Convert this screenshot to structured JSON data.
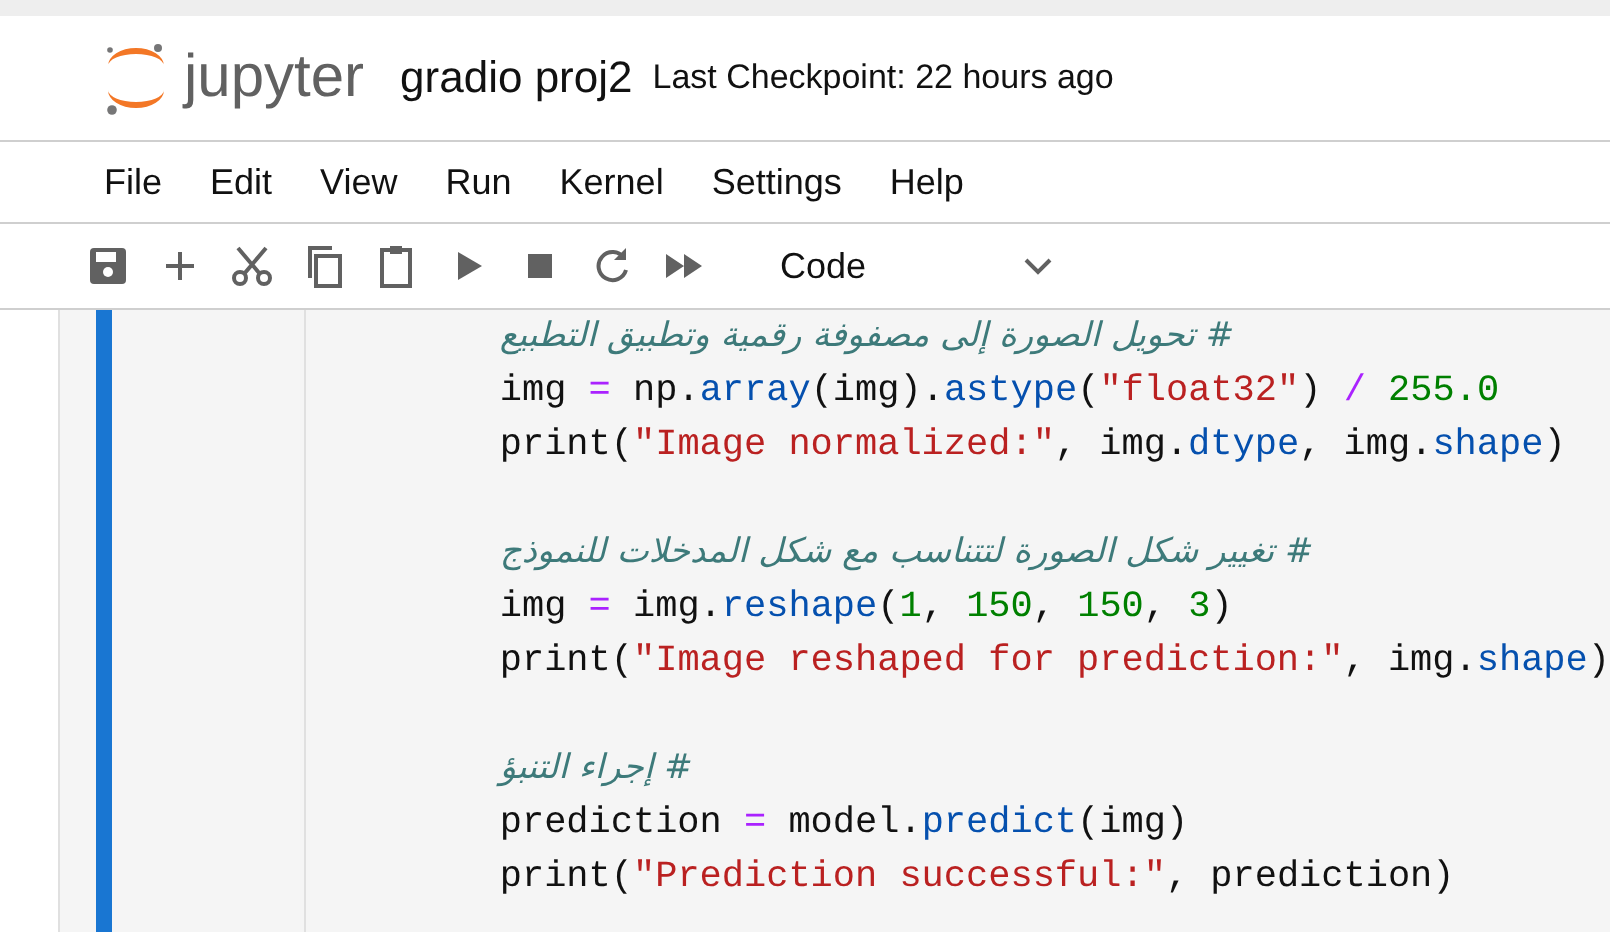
{
  "header": {
    "logo_text": "jupyter",
    "notebook_title": "gradio proj2",
    "checkpoint": "Last Checkpoint: 22 hours ago"
  },
  "menu": [
    "File",
    "Edit",
    "View",
    "Run",
    "Kernel",
    "Settings",
    "Help"
  ],
  "toolbar": {
    "icons": [
      {
        "kind": "save"
      },
      {
        "kind": "add"
      },
      {
        "kind": "cut"
      },
      {
        "kind": "copy"
      },
      {
        "kind": "paste"
      },
      {
        "kind": "run"
      },
      {
        "kind": "stop"
      },
      {
        "kind": "restart"
      },
      {
        "kind": "run-all"
      }
    ],
    "cell_type": "Code"
  },
  "cell": {
    "blocks": [
      {
        "lines": [
          [
            {
              "text": "# تحويل الصورة إلى مصفوفة رقمية وتطبيق التطبيع",
              "kind": "comment"
            }
          ],
          [
            {
              "text": "img ",
              "kind": "plain"
            },
            {
              "text": "=",
              "kind": "op"
            },
            {
              "text": " np.",
              "kind": "plain"
            },
            {
              "text": "array",
              "kind": "attr"
            },
            {
              "text": "(img).",
              "kind": "plain"
            },
            {
              "text": "astype",
              "kind": "attr"
            },
            {
              "text": "(",
              "kind": "plain"
            },
            {
              "text": "\"float32\"",
              "kind": "str"
            },
            {
              "text": ") ",
              "kind": "plain"
            },
            {
              "text": "/",
              "kind": "op"
            },
            {
              "text": " 255.0",
              "kind": "num"
            }
          ],
          [
            {
              "text": "print(",
              "kind": "plain"
            },
            {
              "text": "\"Image normalized:\"",
              "kind": "str"
            },
            {
              "text": ", img.",
              "kind": "plain"
            },
            {
              "text": "dtype",
              "kind": "attr"
            },
            {
              "text": ", img.",
              "kind": "plain"
            },
            {
              "text": "shape",
              "kind": "attr"
            },
            {
              "text": ")",
              "kind": "plain"
            }
          ]
        ]
      },
      {
        "lines": [
          [
            {
              "text": "# تغيير شكل الصورة لتتناسب مع شكل المدخلات للنموذج",
              "kind": "comment"
            }
          ],
          [
            {
              "text": "img ",
              "kind": "plain"
            },
            {
              "text": "=",
              "kind": "op"
            },
            {
              "text": " img.",
              "kind": "plain"
            },
            {
              "text": "reshape",
              "kind": "attr"
            },
            {
              "text": "(",
              "kind": "plain"
            },
            {
              "text": "1",
              "kind": "num"
            },
            {
              "text": ", ",
              "kind": "plain"
            },
            {
              "text": "150",
              "kind": "num"
            },
            {
              "text": ", ",
              "kind": "plain"
            },
            {
              "text": "150",
              "kind": "num"
            },
            {
              "text": ", ",
              "kind": "plain"
            },
            {
              "text": "3",
              "kind": "num"
            },
            {
              "text": ")",
              "kind": "plain"
            }
          ],
          [
            {
              "text": "print(",
              "kind": "plain"
            },
            {
              "text": "\"Image reshaped for prediction:\"",
              "kind": "str"
            },
            {
              "text": ", img.",
              "kind": "plain"
            },
            {
              "text": "shape",
              "kind": "attr"
            },
            {
              "text": ")",
              "kind": "plain"
            }
          ]
        ]
      },
      {
        "lines": [
          [
            {
              "text": "# إجراء التنبؤ",
              "kind": "comment"
            }
          ],
          [
            {
              "text": "prediction ",
              "kind": "plain"
            },
            {
              "text": "=",
              "kind": "op"
            },
            {
              "text": " model.",
              "kind": "plain"
            },
            {
              "text": "predict",
              "kind": "attr"
            },
            {
              "text": "(img)",
              "kind": "plain"
            }
          ],
          [
            {
              "text": "print(",
              "kind": "plain"
            },
            {
              "text": "\"Prediction successful:\"",
              "kind": "str"
            },
            {
              "text": ", prediction)",
              "kind": "plain"
            }
          ]
        ]
      }
    ]
  }
}
